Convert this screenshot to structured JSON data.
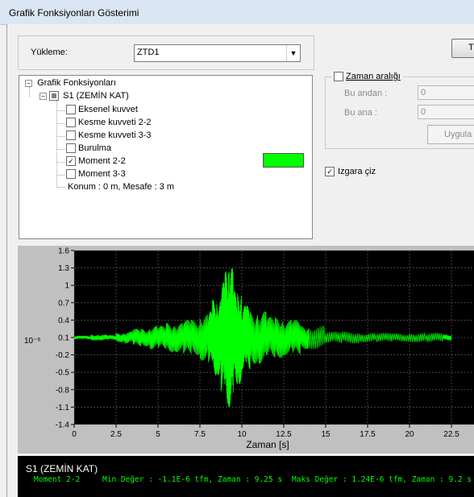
{
  "window": {
    "title": "Grafik Fonksiyonları Gösterimi"
  },
  "load": {
    "label": "Yükleme:",
    "value": "ZTD1"
  },
  "top_right_button": {
    "label": "T"
  },
  "tree": {
    "root": "Grafik Fonksiyonları",
    "node": "S1 (ZEMİN KAT)",
    "items": [
      {
        "label": "Eksenel kuvvet",
        "checked": false
      },
      {
        "label": "Kesme kuvveti 2-2",
        "checked": false
      },
      {
        "label": "Kesme kuvveti 3-3",
        "checked": false
      },
      {
        "label": "Burulma",
        "checked": false
      },
      {
        "label": "Moment 2-2",
        "checked": true
      },
      {
        "label": "Moment 3-3",
        "checked": false
      }
    ],
    "info": "Konum : 0 m, Mesafe : 3 m",
    "swatch_color": "#00ff00"
  },
  "time_range": {
    "label": "Zaman aralığı",
    "from_label": "Bu andan :",
    "from_value": "0",
    "to_label": "Bu ana :",
    "to_value": "0",
    "apply_label": "Uygula"
  },
  "grid_option": {
    "label": "Izgara çiz",
    "checked": true
  },
  "chart_data": {
    "type": "line",
    "xlabel": "Zaman [s]",
    "ylabel": "10⁻⁶",
    "xlim": [
      0,
      22.5
    ],
    "ylim": [
      -1.4,
      1.6
    ],
    "xticks": [
      "0",
      "2.5",
      "5",
      "7.5",
      "10",
      "12.5",
      "15",
      "17.5",
      "20",
      "22.5"
    ],
    "yticks": [
      "1.6",
      "1.3",
      "1",
      "0.7",
      "0.4",
      "0.1",
      "-0.2",
      "-0.5",
      "-0.8",
      "-1.1",
      "-1.4"
    ],
    "grid": true,
    "line_color": "#00ff00",
    "series": [
      {
        "x": [
          0,
          0.5,
          1,
          1.5,
          2,
          2.5,
          3,
          3.5,
          4,
          4.5,
          5,
          5.5,
          6,
          6.5,
          7,
          7.5,
          8,
          8.25,
          8.5,
          8.75,
          9,
          9.2,
          9.25,
          9.5,
          9.75,
          10,
          10.25,
          10.5,
          11,
          11.5,
          12,
          12.5,
          13,
          13.5,
          14,
          15,
          16,
          17,
          18,
          19,
          20,
          21,
          22,
          22.5
        ],
        "y": [
          0.1,
          0.07,
          0.13,
          0.05,
          0.14,
          0.06,
          0.18,
          0.0,
          0.25,
          -0.05,
          0.3,
          -0.1,
          0.35,
          -0.15,
          0.4,
          -0.2,
          0.5,
          -0.35,
          0.75,
          -0.55,
          1.05,
          1.24,
          -1.1,
          0.9,
          -0.7,
          0.6,
          -0.45,
          0.45,
          -0.35,
          0.35,
          -0.25,
          0.3,
          -0.2,
          0.28,
          -0.1,
          0.2,
          0.0,
          0.18,
          0.02,
          0.17,
          0.03,
          0.18,
          0.05,
          0.15
        ]
      }
    ]
  },
  "status": {
    "title": "S1 (ZEMİN KAT)",
    "series": "Moment 2-2",
    "min": "Min Değer : -1.1E-6 tfm, Zaman : 9.25 s",
    "max": "Maks Değer : 1.24E-6 tfm, Zaman : 9.2 s"
  }
}
